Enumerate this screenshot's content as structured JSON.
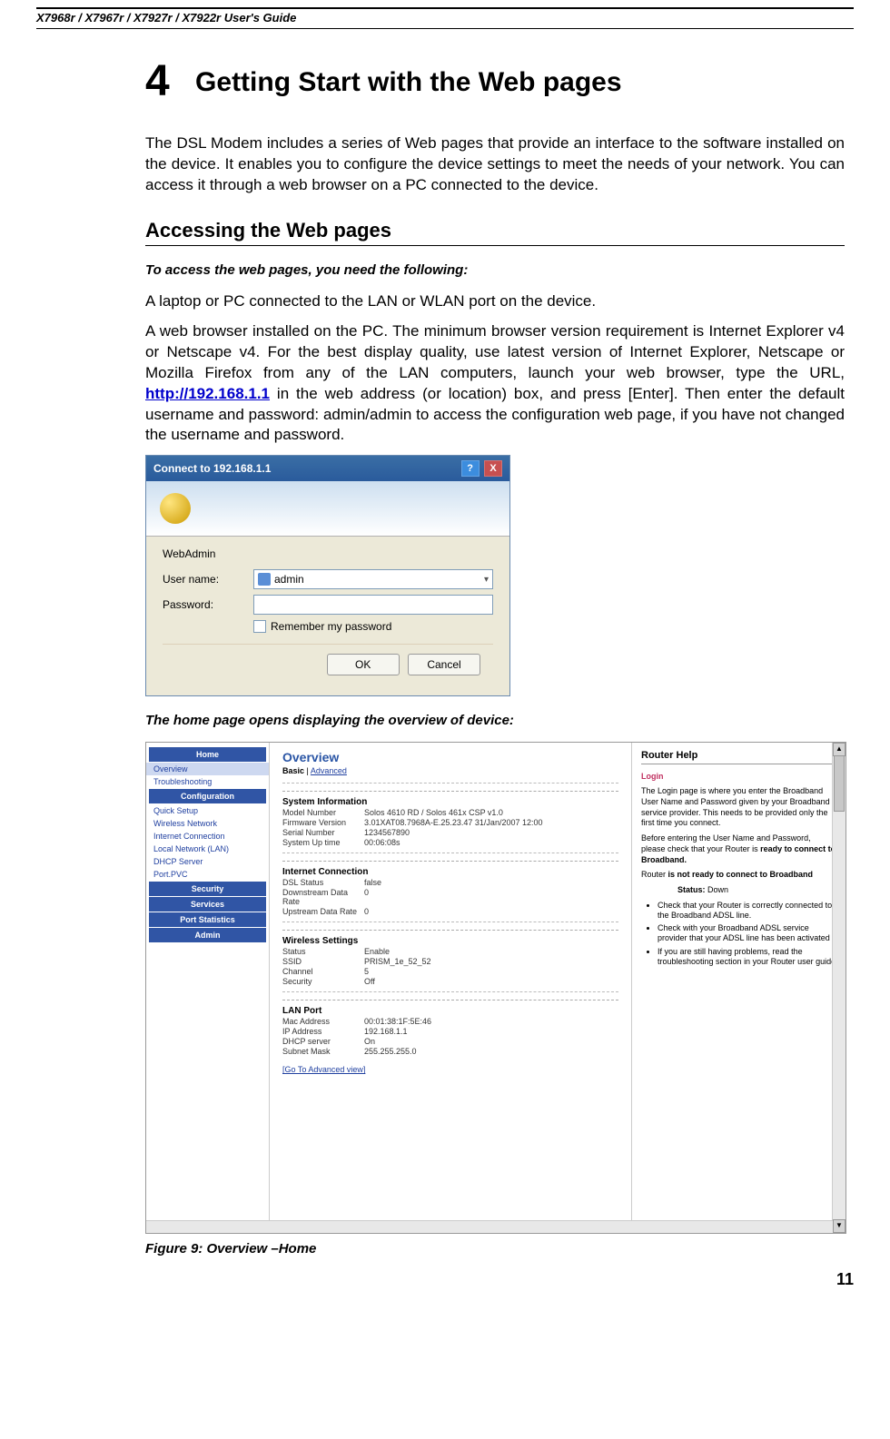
{
  "header": {
    "guide_title": "X7968r / X7967r / X7927r / X7922r User's Guide"
  },
  "chapter": {
    "number": "4",
    "title": "Getting Start with the Web pages"
  },
  "intro_para": "The DSL Modem includes a series of Web pages that provide an interface to the software installed on the device. It enables you to configure the device settings to meet the needs of your network. You can access it through a web browser on a PC connected to the device.",
  "section1": {
    "heading": "Accessing the Web pages"
  },
  "sub1": "To access the web pages, you need the following:",
  "para1": "A laptop or PC connected to the LAN or WLAN port on the device.",
  "para2a": "A web browser installed on the PC. The minimum browser version requirement is Internet Explorer v4 or Netscape v4. For the best display quality, use latest version of Internet Explorer, Netscape or Mozilla Firefox  from any of the LAN computers, launch your web browser, type the URL, ",
  "url": "http://192.168.1.1",
  "para2b": " in the web address (or location) box, and press [Enter]. Then enter the default username and password: admin/admin to access the configuration web page, if you have not changed the username and password.",
  "login": {
    "title": "Connect to 192.168.1.1",
    "realm": "WebAdmin",
    "user_label": "User name:",
    "pass_label": "Password:",
    "user_value": "admin",
    "remember": "Remember my password",
    "ok": "OK",
    "cancel": "Cancel"
  },
  "sub2": "The home page opens displaying the overview of device:",
  "overview": {
    "side_sections": {
      "home": "Home",
      "home_items": [
        "Overview",
        "Troubleshooting"
      ],
      "config": "Configuration",
      "config_items": [
        "Quick Setup",
        "Wireless Network",
        "Internet Connection",
        "Local Network (LAN)",
        "DHCP Server",
        "Port.PVC"
      ],
      "security": "Security",
      "services": "Services",
      "portstats": "Port Statistics",
      "admin": "Admin"
    },
    "main": {
      "title": "Overview",
      "tab_basic": "Basic",
      "tab_adv": "Advanced",
      "sys_h": "System Information",
      "sys": [
        {
          "k": "Model Number",
          "v": "Solos 4610 RD / Solos 461x CSP v1.0"
        },
        {
          "k": "Firmware Version",
          "v": "3.01XAT08.7968A-E.25.23.47 31/Jan/2007 12:00"
        },
        {
          "k": "Serial Number",
          "v": "1234567890"
        },
        {
          "k": "System Up time",
          "v": "00:06:08s"
        }
      ],
      "ic_h": "Internet Connection",
      "ic": [
        {
          "k": "DSL Status",
          "v": "false"
        },
        {
          "k": "Downstream Data Rate",
          "v": "0"
        },
        {
          "k": "Upstream Data Rate",
          "v": "0"
        }
      ],
      "ws_h": "Wireless Settings",
      "ws": [
        {
          "k": "Status",
          "v": "Enable"
        },
        {
          "k": "SSID",
          "v": "PRISM_1e_52_52"
        },
        {
          "k": "Channel",
          "v": "5"
        },
        {
          "k": "Security",
          "v": "Off"
        }
      ],
      "lan_h": "LAN Port",
      "lan": [
        {
          "k": "Mac Address",
          "v": "00:01:38:1F:5E:46"
        },
        {
          "k": "IP Address",
          "v": "192.168.1.1"
        },
        {
          "k": "DHCP server",
          "v": "On"
        },
        {
          "k": "Subnet Mask",
          "v": "255.255.255.0"
        }
      ],
      "go_adv": "[Go To Advanced view]"
    },
    "help": {
      "title": "Router Help",
      "login_h": "Login",
      "p1": "The Login page is where you enter the Broadband User Name and Password given by your Broadband service provider. This needs to be provided only the first time you connect.",
      "p2a": "Before entering the User Name and Password, please check that your Router is ",
      "p2b": "ready to connect to Broadband.",
      "p3a": "Router ",
      "p3b": "is not ready to connect to Broadband",
      "status_lbl": "Status:",
      "status_val": "Down",
      "bullets": [
        "Check that your Router is correctly connected to the Broadband ADSL line.",
        "Check with your Broadband ADSL service provider that your ADSL line has been activated",
        "If you are still having problems, read the troubleshooting section in your Router user guide"
      ]
    }
  },
  "figure_caption": "Figure 9: Overview –Home",
  "page_number": "11"
}
